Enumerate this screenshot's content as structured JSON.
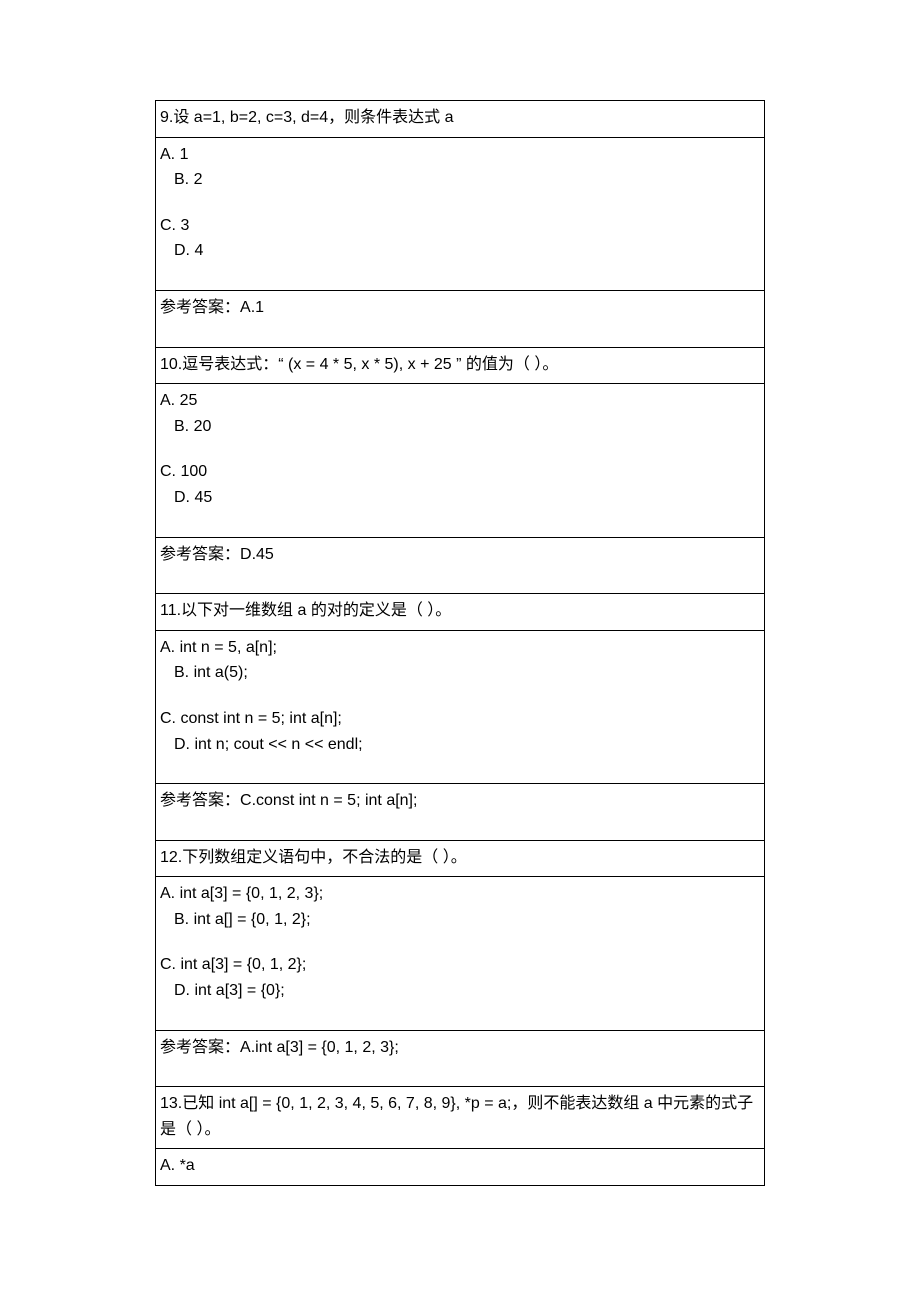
{
  "labels": {
    "answer": "参考答案："
  },
  "q9": {
    "question": "9.设 a=1, b=2, c=3, d=4，则条件表达式 a",
    "options": [
      "A. 1",
      "B. 2",
      "C. 3",
      "D. 4"
    ],
    "answer": "A.1"
  },
  "q10": {
    "question": "10.逗号表达式：“ (x = 4 * 5, x * 5), x + 25 ” 的值为（ ）。",
    "options": [
      "A. 25",
      "B. 20",
      "C. 100",
      "D. 45"
    ],
    "answer": "D.45"
  },
  "q11": {
    "question": "11.以下对一维数组 a 的对的定义是（ ）。",
    "options": [
      "A. int n = 5, a[n];",
      "B. int a(5);",
      "C. const int n = 5; int a[n];",
      "D. int n; cout << n << endl;"
    ],
    "answer": "C.const int n = 5; int a[n];"
  },
  "q12": {
    "question": "12.下列数组定义语句中，不合法的是（ ）。",
    "options": [
      "A. int a[3] = {0, 1, 2, 3};",
      "B. int a[] = {0, 1, 2};",
      "C. int a[3] = {0, 1, 2};",
      "D. int a[3] = {0};"
    ],
    "answer": "A.int a[3] = {0, 1, 2, 3};"
  },
  "q13": {
    "question": "13.已知 int a[] = {0, 1, 2, 3, 4, 5, 6, 7, 8, 9}, *p = a;，则不能表达数组 a 中元素的式子是（ ）。",
    "options": [
      "A. *a"
    ]
  }
}
